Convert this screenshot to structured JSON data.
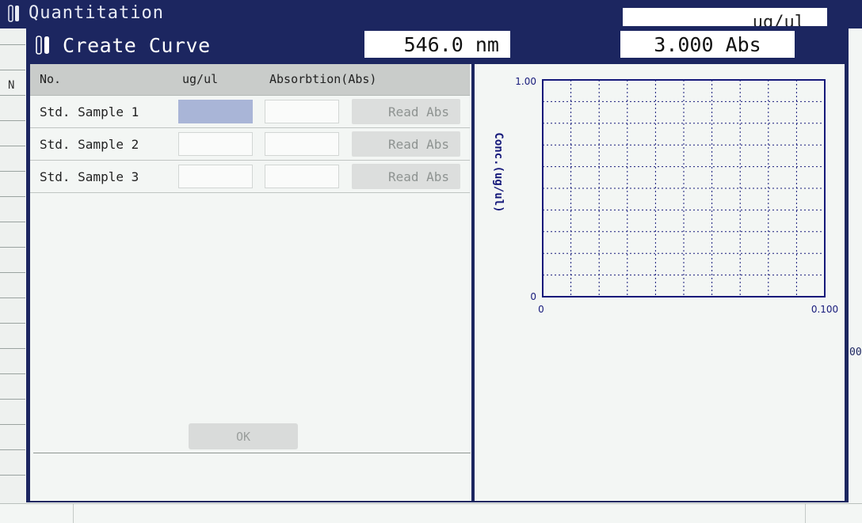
{
  "background": {
    "title": "Quantitation",
    "unit": "ug/ul",
    "column_letter": "N",
    "side_fragment": "00"
  },
  "dialog": {
    "title": "Create Curve",
    "wavelength": "546.0 nm",
    "absorbance": "3.000 Abs",
    "table": {
      "headers": [
        "No.",
        "ug/ul",
        "Absorbtion(Abs)"
      ],
      "rows": [
        {
          "label": "Std. Sample 1",
          "conc": "",
          "abs": "",
          "button": "Read Abs",
          "active": true
        },
        {
          "label": "Std. Sample 2",
          "conc": "",
          "abs": "",
          "button": "Read Abs",
          "active": false
        },
        {
          "label": "Std. Sample 3",
          "conc": "",
          "abs": "",
          "button": "Read Abs",
          "active": false
        }
      ]
    },
    "ok_label": "OK"
  },
  "chart_data": {
    "type": "scatter",
    "title": "",
    "xlabel": "Absorbtion(Abs)",
    "ylabel": "Conc.(ug/ul)",
    "xlim": [
      0,
      0.1
    ],
    "ylim": [
      0,
      1.0
    ],
    "x_tick_labels": [
      "0",
      "0.100"
    ],
    "y_tick_labels": [
      "0",
      "1.00"
    ],
    "grid": true,
    "series": [],
    "colors": {
      "axis": "#15197a",
      "grid": "#15197a",
      "label": "#15197a"
    }
  }
}
